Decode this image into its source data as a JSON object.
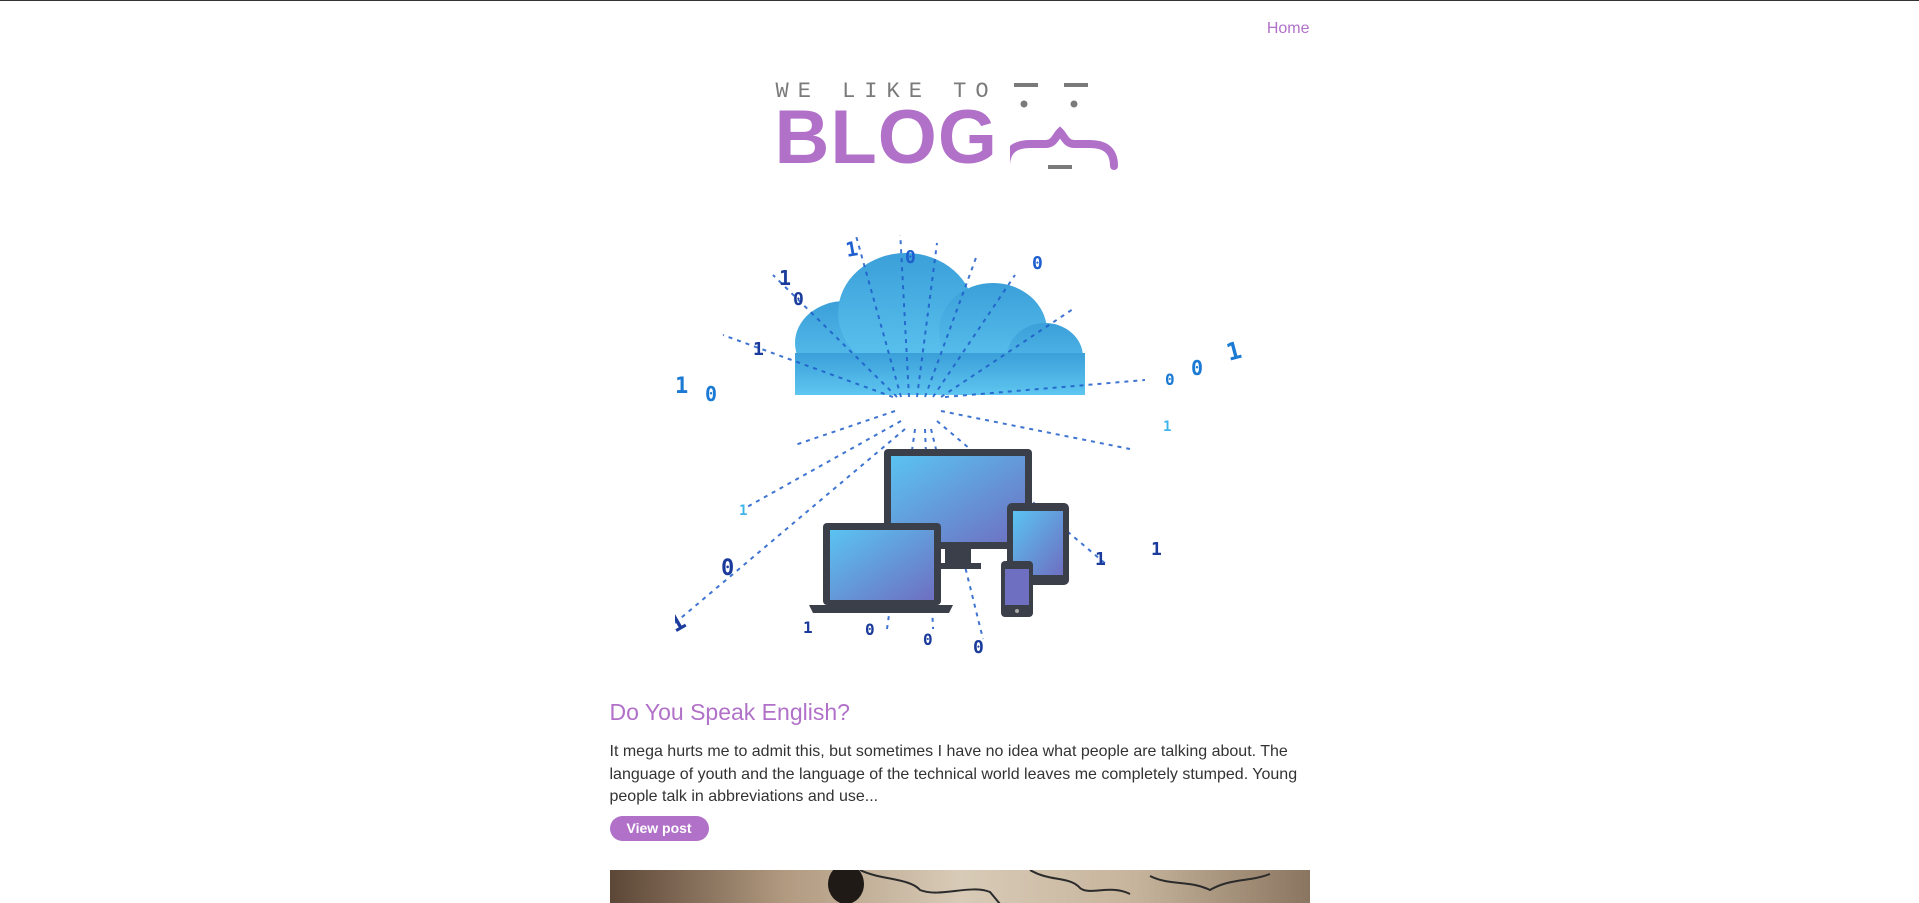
{
  "nav": {
    "home_label": "Home"
  },
  "logo": {
    "tagline": "WE LIKE TO",
    "title": "BLOG"
  },
  "hero": {
    "icon": "cloud-devices-binary-illustration"
  },
  "post": {
    "title": "Do You Speak English?",
    "excerpt": "It mega hurts me to admit this, but sometimes I have no idea what people are talking about. The language of youth and the language of the technical world leaves me completely stumped. Young people talk in abbreviations and use...",
    "button_label": "View post"
  },
  "colors": {
    "accent": "#b171c9",
    "text": "#333333",
    "logo_gray": "#7a7a7a"
  }
}
